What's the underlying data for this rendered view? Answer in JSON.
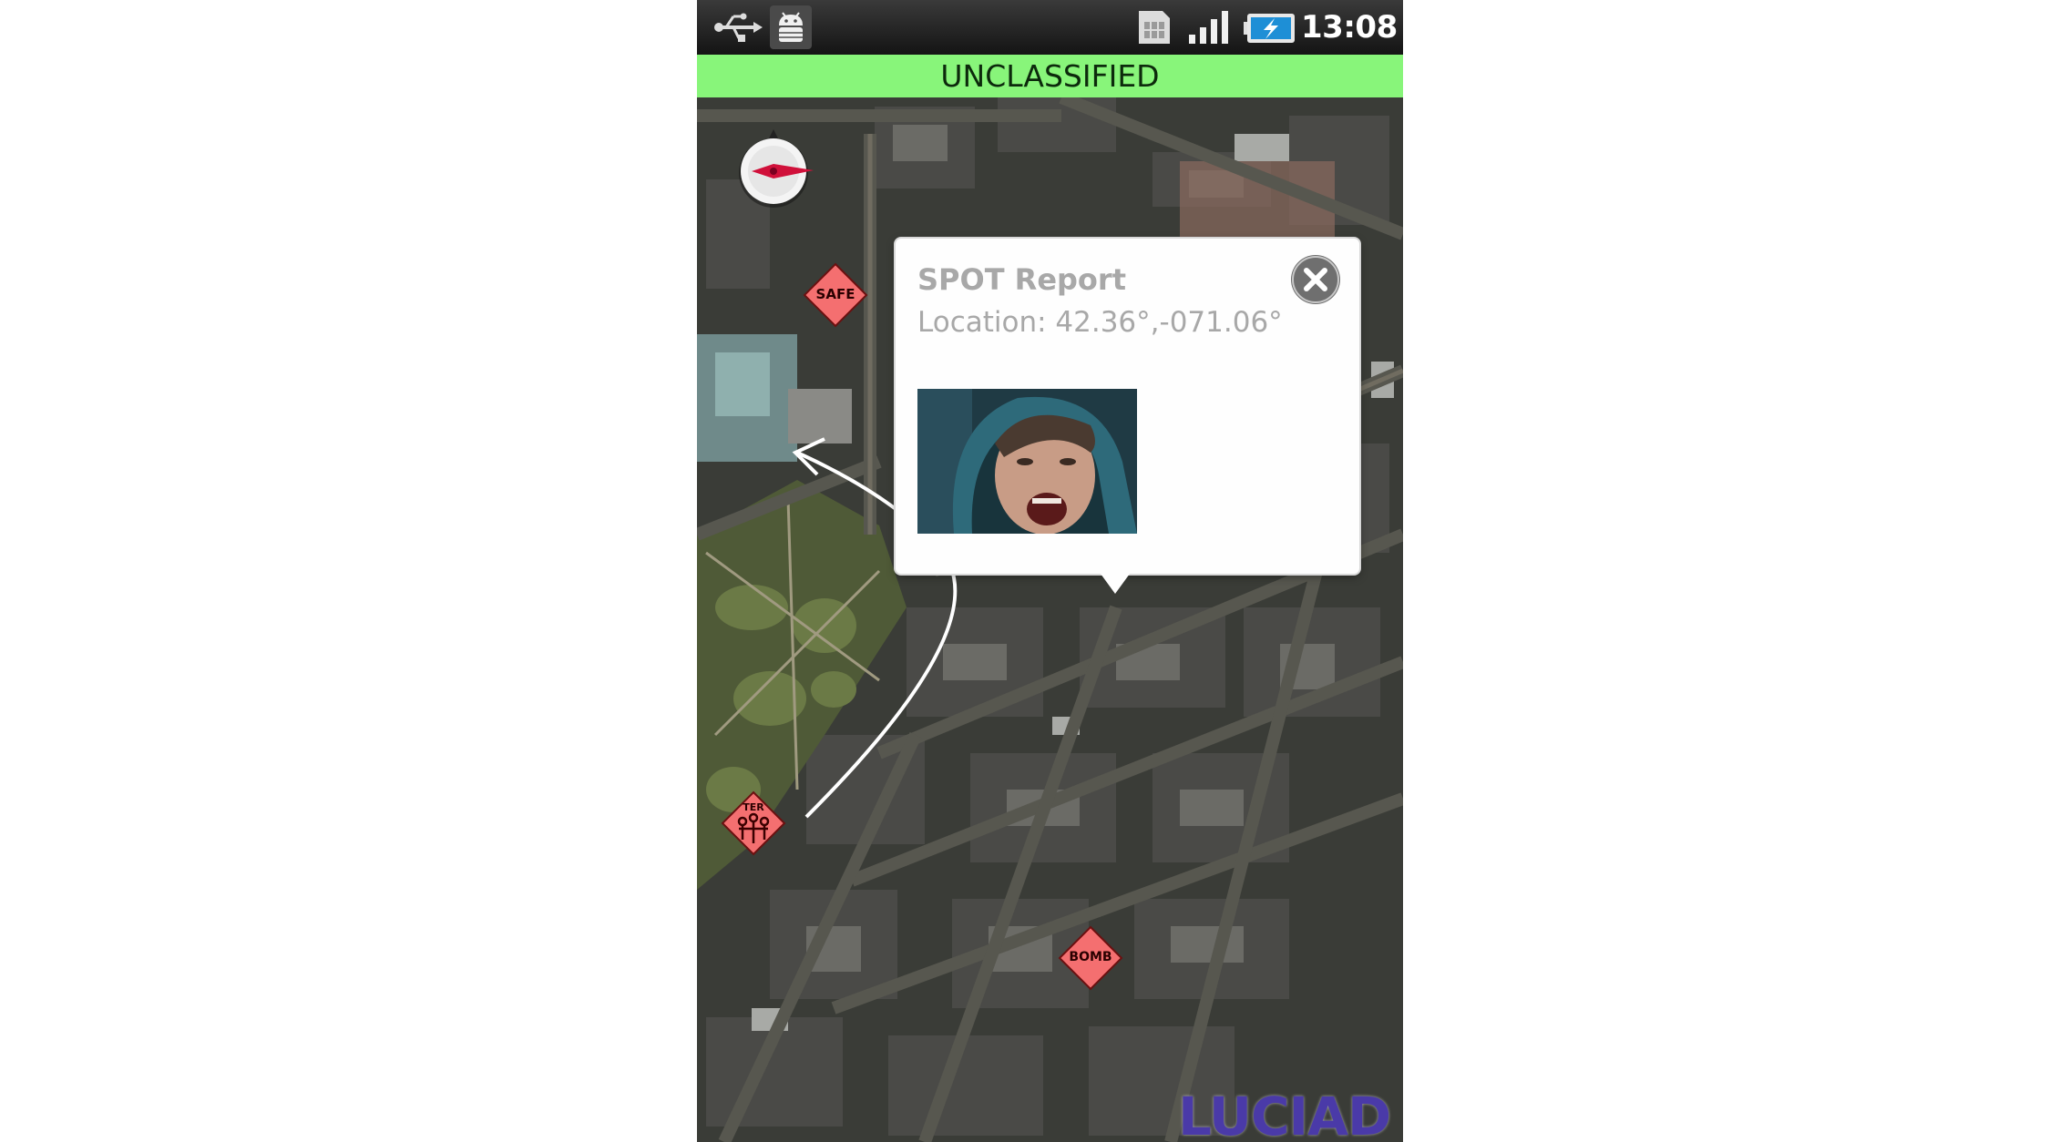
{
  "status_bar": {
    "time": "13:08",
    "icons": [
      "usb-icon",
      "android-debug-icon",
      "sim-card-icon",
      "signal-bars-icon",
      "battery-charging-icon"
    ]
  },
  "classification": {
    "label": "UNCLASSIFIED",
    "color": "#88f57a"
  },
  "popup": {
    "title": "SPOT Report",
    "location": "Location: 42.36°,-071.06°",
    "close_icon": "close-icon"
  },
  "markers": [
    {
      "id": "safe",
      "label": "SAFE",
      "color": "#f46f70"
    },
    {
      "id": "spot",
      "label": "",
      "icon": "antenna-group-icon",
      "color": "#f46f70"
    },
    {
      "id": "ter",
      "label": "TER",
      "icon": "antenna-group-icon",
      "color": "#f46f70"
    },
    {
      "id": "bomb",
      "label": "BOMB",
      "color": "#f46f70"
    }
  ],
  "compass": {
    "icon": "compass-icon"
  },
  "logo": {
    "text": "LUCIAD",
    "color": "#4a3aa8"
  }
}
